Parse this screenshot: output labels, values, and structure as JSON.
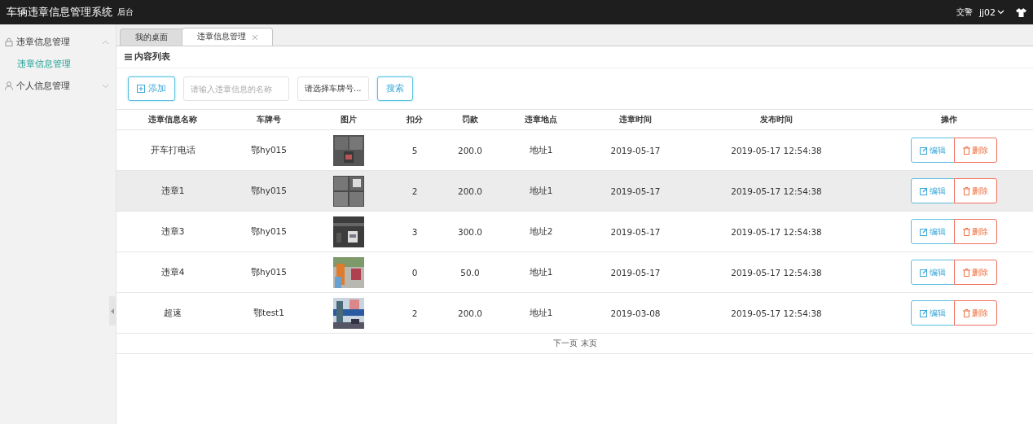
{
  "header": {
    "title": "车辆违章信息管理系统",
    "subtitle": "后台",
    "role": "交警",
    "user": "jj02"
  },
  "sidebar": {
    "items": [
      {
        "label": "违章信息管理",
        "expanded": true,
        "children": [
          {
            "label": "违章信息管理",
            "selected": true
          }
        ]
      },
      {
        "label": "个人信息管理",
        "expanded": false
      }
    ]
  },
  "tabs": [
    {
      "label": "我的桌面",
      "selected": false
    },
    {
      "label": "违章信息管理",
      "selected": true
    }
  ],
  "panel": {
    "title": "内容列表"
  },
  "toolbar": {
    "add_button": "添加",
    "name_field": {
      "placeholder": "请输入违章信息的名称"
    },
    "plate_select": "请选择车牌号...",
    "search_button": "搜索"
  },
  "table": {
    "columns": [
      "违章信息名称",
      "车牌号",
      "图片",
      "扣分",
      "罚款",
      "违章地点",
      "违章时间",
      "发布时间",
      "操作"
    ],
    "rows": [
      {
        "name": "开车打电话",
        "plate": "鄂hy015",
        "points": "5",
        "fine": "200.0",
        "location": "地址1",
        "date": "2019-05-17",
        "published": "2019-05-17 12:54:38",
        "edit": "编辑",
        "delete": "删除",
        "selected": false
      },
      {
        "name": "违章1",
        "plate": "鄂hy015",
        "points": "2",
        "fine": "200.0",
        "location": "地址1",
        "date": "2019-05-17",
        "published": "2019-05-17 12:54:38",
        "edit": "编辑",
        "delete": "删除",
        "selected": true
      },
      {
        "name": "违章3",
        "plate": "鄂hy015",
        "points": "3",
        "fine": "300.0",
        "location": "地址2",
        "date": "2019-05-17",
        "published": "2019-05-17 12:54:38",
        "edit": "编辑",
        "delete": "删除",
        "selected": false
      },
      {
        "name": "违章4",
        "plate": "鄂hy015",
        "points": "0",
        "fine": "50.0",
        "location": "地址1",
        "date": "2019-05-17",
        "published": "2019-05-17 12:54:38",
        "edit": "编辑",
        "delete": "删除",
        "selected": false
      },
      {
        "name": "超速",
        "plate": "鄂test1",
        "points": "2",
        "fine": "200.0",
        "location": "地址1",
        "date": "2019-03-08",
        "published": "2019-05-17 12:54:38",
        "edit": "编辑",
        "delete": "删除",
        "selected": false
      }
    ]
  },
  "pagination": {
    "next": "下一页",
    "last": "末页"
  }
}
